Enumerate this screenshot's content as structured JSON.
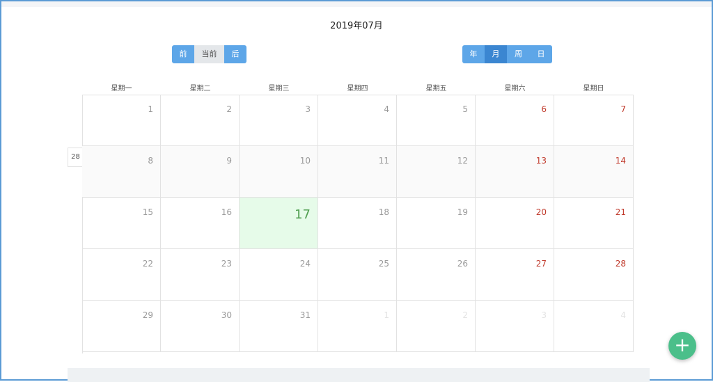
{
  "header": {
    "title": "2019年07月"
  },
  "nav": {
    "prev": "前",
    "current": "当前",
    "next": "后"
  },
  "views": {
    "year": "年",
    "month": "月",
    "week": "周",
    "day": "日"
  },
  "weekdays": [
    "星期一",
    "星期二",
    "星期三",
    "星期四",
    "星期五",
    "星期六",
    "星期日"
  ],
  "week_label": "28",
  "weeks": [
    [
      "1",
      "2",
      "3",
      "4",
      "5",
      "6",
      "7"
    ],
    [
      "8",
      "9",
      "10",
      "11",
      "12",
      "13",
      "14"
    ],
    [
      "15",
      "16",
      "17",
      "18",
      "19",
      "20",
      "21"
    ],
    [
      "22",
      "23",
      "24",
      "25",
      "26",
      "27",
      "28"
    ],
    [
      "29",
      "30",
      "31",
      "1",
      "2",
      "3",
      "4"
    ]
  ],
  "fab": {
    "label": "+"
  },
  "colors": {
    "accent": "#5da6e8",
    "weekend": "#c0392b",
    "today_bg": "#e6fbe9",
    "fab": "#4bbf8a"
  }
}
